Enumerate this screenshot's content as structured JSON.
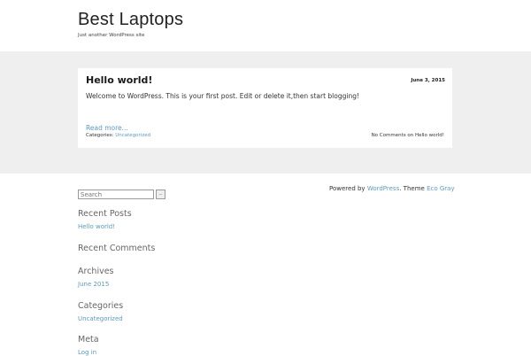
{
  "header": {
    "site_title": "Best Laptops",
    "site_description": "Just another WordPress site"
  },
  "post": {
    "title": "Hello world!",
    "date": "June 3, 2015",
    "excerpt": "Welcome to WordPress. This is your first post. Edit or delete it,then start blogging!",
    "read_more": "Read more...",
    "categories_label": "Categories:",
    "category": "Uncategorized",
    "comments": "No Comments on Hello world!"
  },
  "footer": {
    "powered_by": "Powered by",
    "wordpress_link": "WordPress",
    "theme_text": ". Theme",
    "theme_link": "Eco Gray"
  },
  "sidebar": {
    "search": {
      "placeholder": "Search",
      "button_label": "..."
    },
    "recent_posts": {
      "title": "Recent Posts",
      "items": [
        "Hello world!"
      ]
    },
    "recent_comments": {
      "title": "Recent Comments"
    },
    "archives": {
      "title": "Archives",
      "items": [
        "June 2015"
      ]
    },
    "categories": {
      "title": "Categories",
      "items": [
        "Uncategorized"
      ]
    },
    "meta": {
      "title": "Meta",
      "items": [
        "Log in"
      ]
    }
  },
  "colors": {
    "link": "#5b9bc0",
    "band": "#efefef",
    "widget_title": "#666666"
  }
}
